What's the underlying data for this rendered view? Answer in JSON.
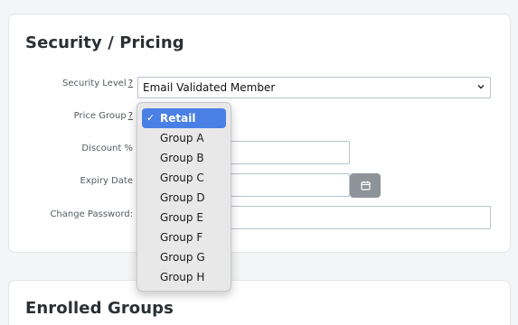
{
  "security_card": {
    "title": "Security / Pricing",
    "security_level": {
      "label": "Security Level",
      "help": "?",
      "value": "Email Validated Member"
    },
    "price_group": {
      "label": "Price Group",
      "help": "?"
    },
    "discount": {
      "label": "Discount %",
      "value": ""
    },
    "expiry_date": {
      "label": "Expiry Date",
      "value": ""
    },
    "change_password": {
      "label": "Change Password:",
      "value": ""
    },
    "price_group_dropdown": {
      "selected": "Retail",
      "check": "✓",
      "options": [
        "Retail",
        "Group A",
        "Group B",
        "Group C",
        "Group D",
        "Group E",
        "Group F",
        "Group G",
        "Group H"
      ]
    }
  },
  "enrolled_card": {
    "title": "Enrolled Groups"
  },
  "colors": {
    "accent": "#4a7fe6",
    "calendar_button": "#8e9399",
    "field_border": "#b9c2cf"
  },
  "icons": {
    "calendar": "calendar-icon",
    "chevron": "chevron-down-icon"
  }
}
